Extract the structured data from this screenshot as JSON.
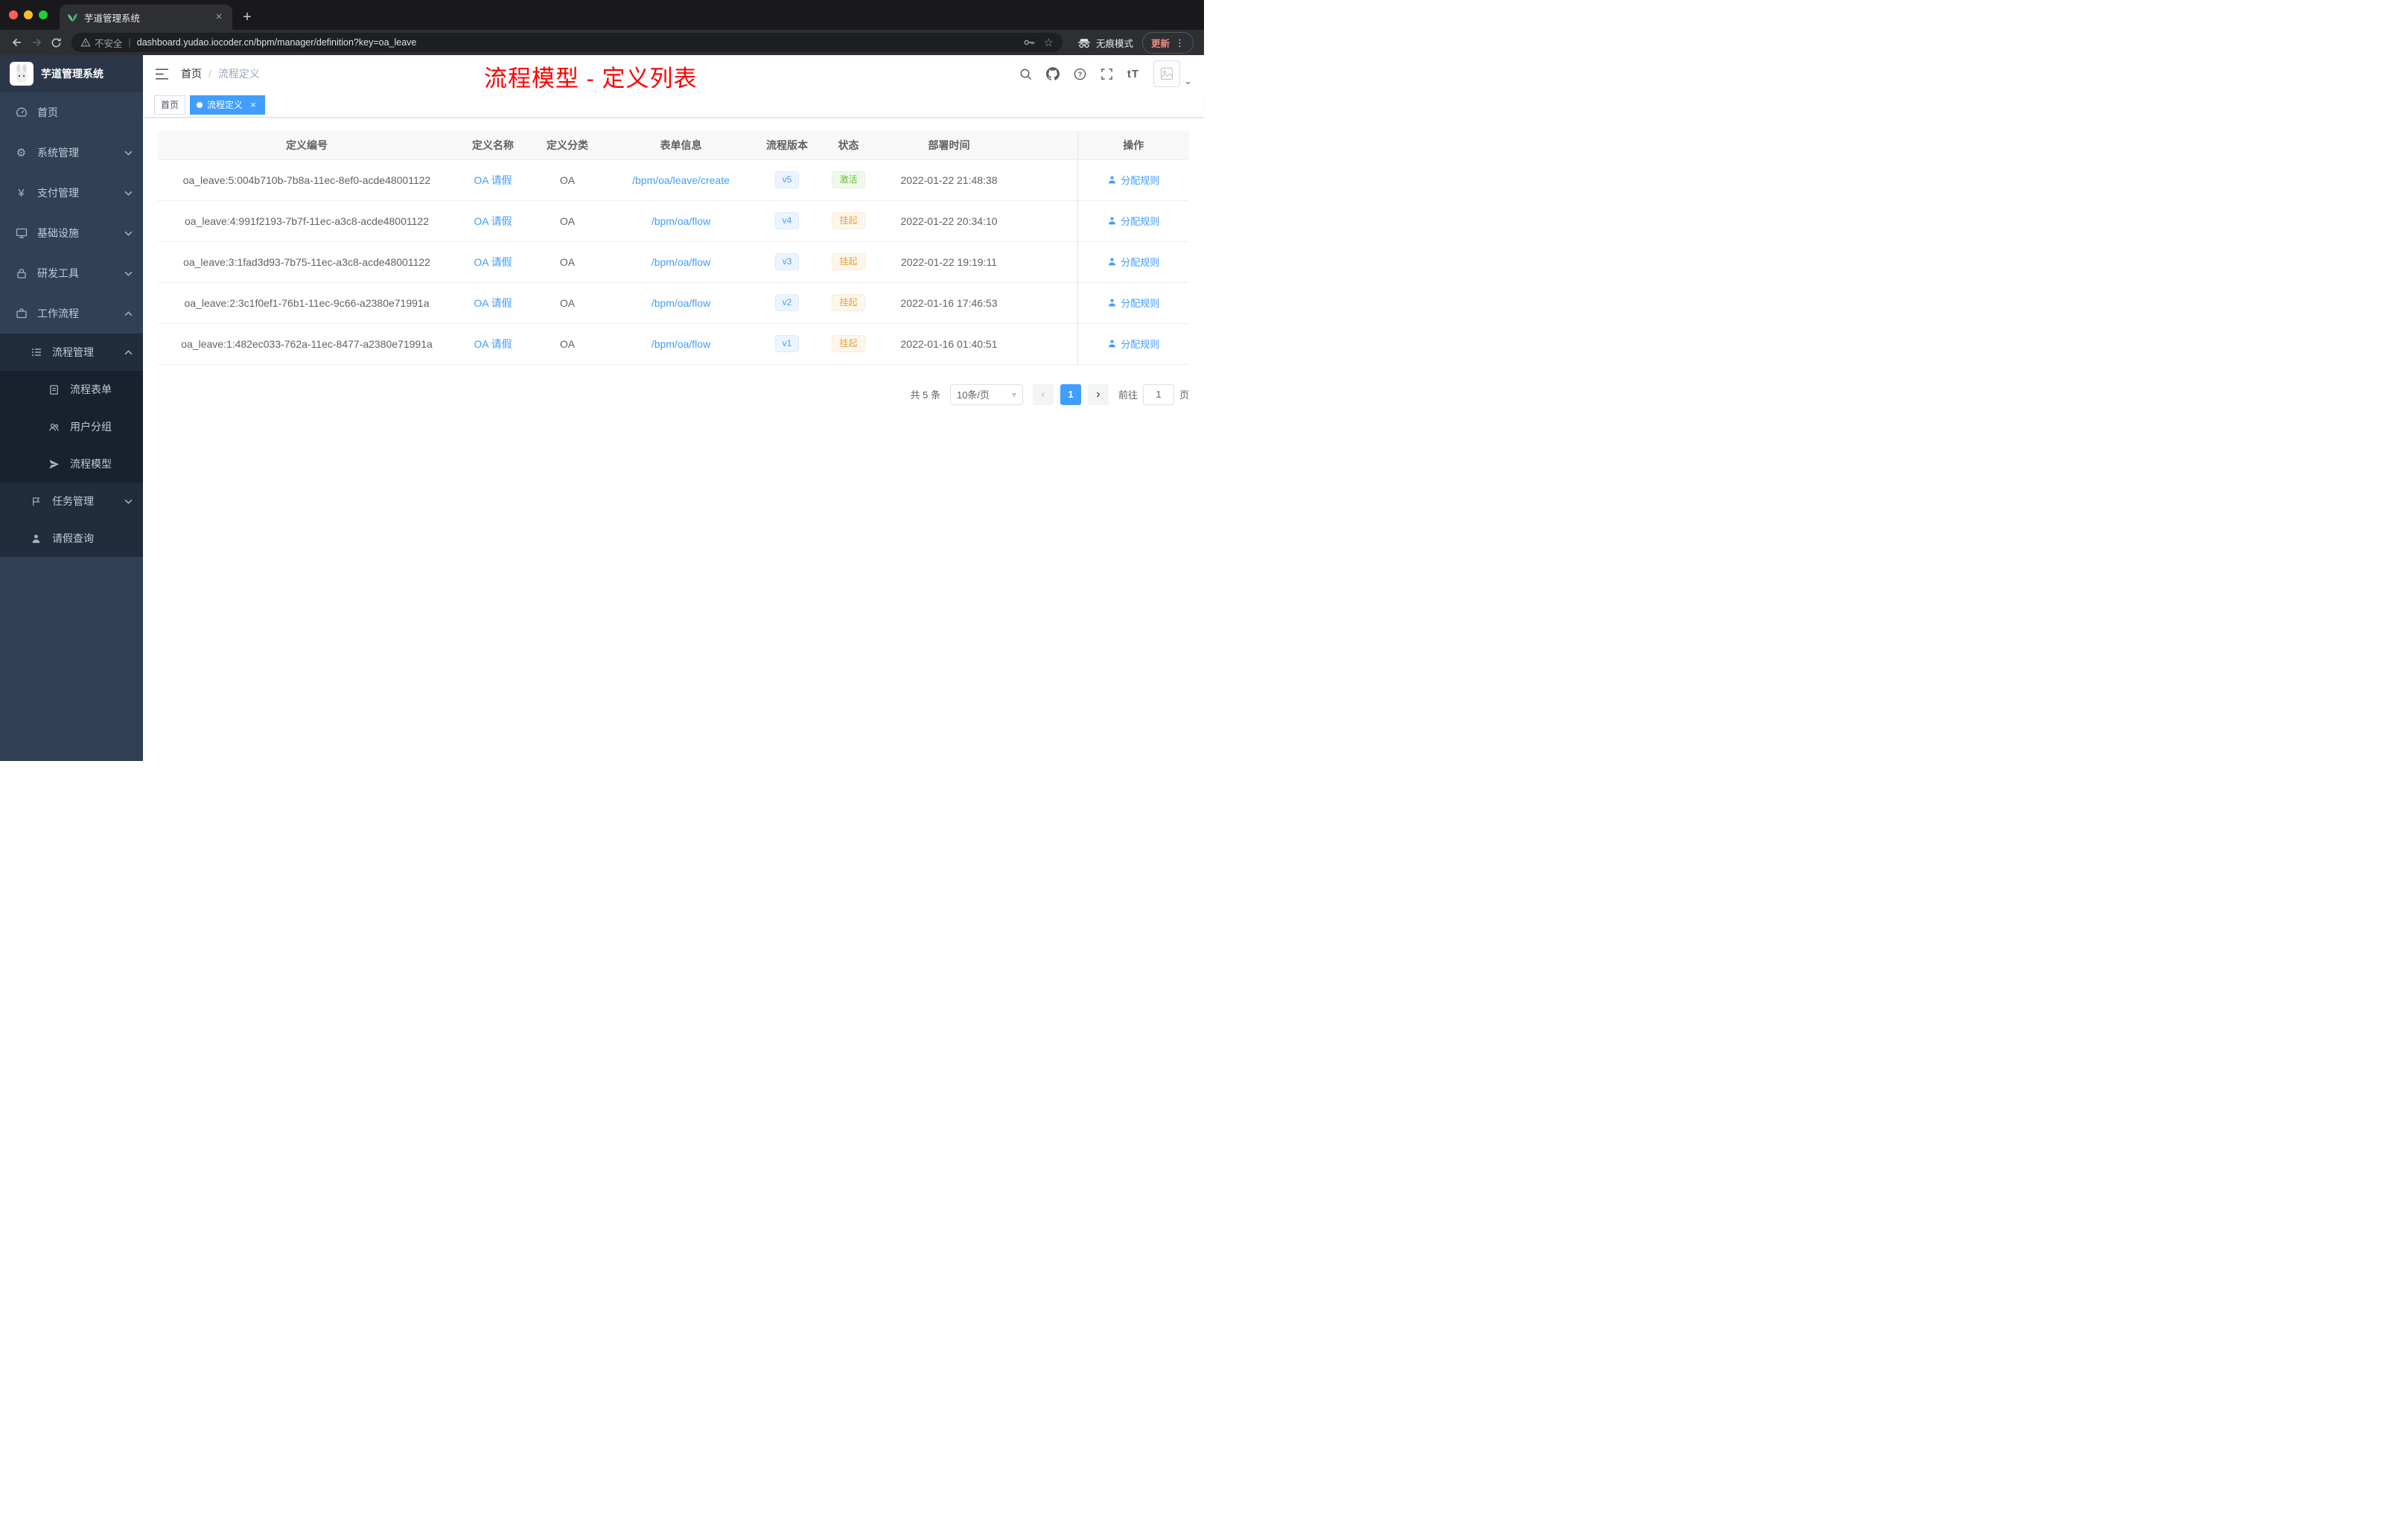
{
  "colors": {
    "accent": "#409eff",
    "success": "#67c23a",
    "warning": "#e6a23c",
    "annotation": "#fd0000",
    "sidebar_bg": "#304156",
    "sidebar_submenu_bg": "#1f2d3d",
    "link": "#409eff"
  },
  "icons": {
    "tab_close": "×",
    "new_tab": "+",
    "menu_dots": "⋮",
    "bookmark_star": "☆",
    "gear_glyph": "⚙",
    "yen_glyph": "¥",
    "prev_arrow": "‹",
    "next_arrow": "›",
    "tag_close": "×",
    "caret_down": "⌄",
    "select_caret": "▾"
  },
  "browser": {
    "tab_title": "芋道管理系统",
    "security_label": "不安全",
    "url": "dashboard.yudao.iocoder.cn/bpm/manager/definition?key=oa_leave",
    "incognito_label": "无痕模式",
    "update_label": "更新"
  },
  "sidebar": {
    "logo_title": "芋道管理系统",
    "items": [
      {
        "label": "首页",
        "icon": "dashboard-icon"
      },
      {
        "label": "系统管理",
        "icon": "gear-icon",
        "chevron": "down"
      },
      {
        "label": "支付管理",
        "icon": "yen-icon",
        "chevron": "down"
      },
      {
        "label": "基础设施",
        "icon": "monitor-icon",
        "chevron": "down"
      },
      {
        "label": "研发工具",
        "icon": "lock-icon",
        "chevron": "down"
      },
      {
        "label": "工作流程",
        "icon": "briefcase-icon",
        "chevron": "up"
      }
    ],
    "workflow_menu": {
      "process_mgmt": {
        "label": "流程管理",
        "chevron": "up"
      },
      "children": [
        {
          "label": "流程表单",
          "icon": "form-icon"
        },
        {
          "label": "用户分组",
          "icon": "users-icon"
        },
        {
          "label": "流程模型",
          "icon": "send-icon"
        }
      ],
      "task_mgmt": {
        "label": "任务管理",
        "chevron": "down"
      },
      "leave_query": {
        "label": "请假查询",
        "icon": "person-icon"
      }
    }
  },
  "navbar": {
    "breadcrumb": [
      "首页",
      "流程定义"
    ],
    "separator": "/",
    "annotation": "流程模型 - 定义列表",
    "font_icon_text": "tT"
  },
  "tags": {
    "home": "首页",
    "active": "流程定义"
  },
  "table": {
    "columns": [
      "定义编号",
      "定义名称",
      "定义分类",
      "表单信息",
      "流程版本",
      "状态",
      "部署时间",
      "操作"
    ],
    "rows": [
      {
        "id": "oa_leave:5:004b710b-7b8a-11ec-8ef0-acde48001122",
        "name": "OA 请假",
        "category": "OA",
        "form": "/bpm/oa/leave/create",
        "version": "v5",
        "status": "激活",
        "status_type": "success",
        "deploy_time": "2022-01-22 21:48:38",
        "action": "分配规则"
      },
      {
        "id": "oa_leave:4:991f2193-7b7f-11ec-a3c8-acde48001122",
        "name": "OA 请假",
        "category": "OA",
        "form": "/bpm/oa/flow",
        "version": "v4",
        "status": "挂起",
        "status_type": "warning",
        "deploy_time": "2022-01-22 20:34:10",
        "action": "分配规则"
      },
      {
        "id": "oa_leave:3:1fad3d93-7b75-11ec-a3c8-acde48001122",
        "name": "OA 请假",
        "category": "OA",
        "form": "/bpm/oa/flow",
        "version": "v3",
        "status": "挂起",
        "status_type": "warning",
        "deploy_time": "2022-01-22 19:19:11",
        "action": "分配规则"
      },
      {
        "id": "oa_leave:2:3c1f0ef1-76b1-11ec-9c66-a2380e71991a",
        "name": "OA 请假",
        "category": "OA",
        "form": "/bpm/oa/flow",
        "version": "v2",
        "status": "挂起",
        "status_type": "warning",
        "deploy_time": "2022-01-16 17:46:53",
        "action": "分配规则"
      },
      {
        "id": "oa_leave:1:482ec033-762a-11ec-8477-a2380e71991a",
        "name": "OA 请假",
        "category": "OA",
        "form": "/bpm/oa/flow",
        "version": "v1",
        "status": "挂起",
        "status_type": "warning",
        "deploy_time": "2022-01-16 01:40:51",
        "action": "分配规则"
      }
    ]
  },
  "pagination": {
    "total": "共 5 条",
    "page_size": "10条/页",
    "current_page": "1",
    "goto_label": "前往",
    "goto_value": "1",
    "goto_suffix": "页"
  }
}
